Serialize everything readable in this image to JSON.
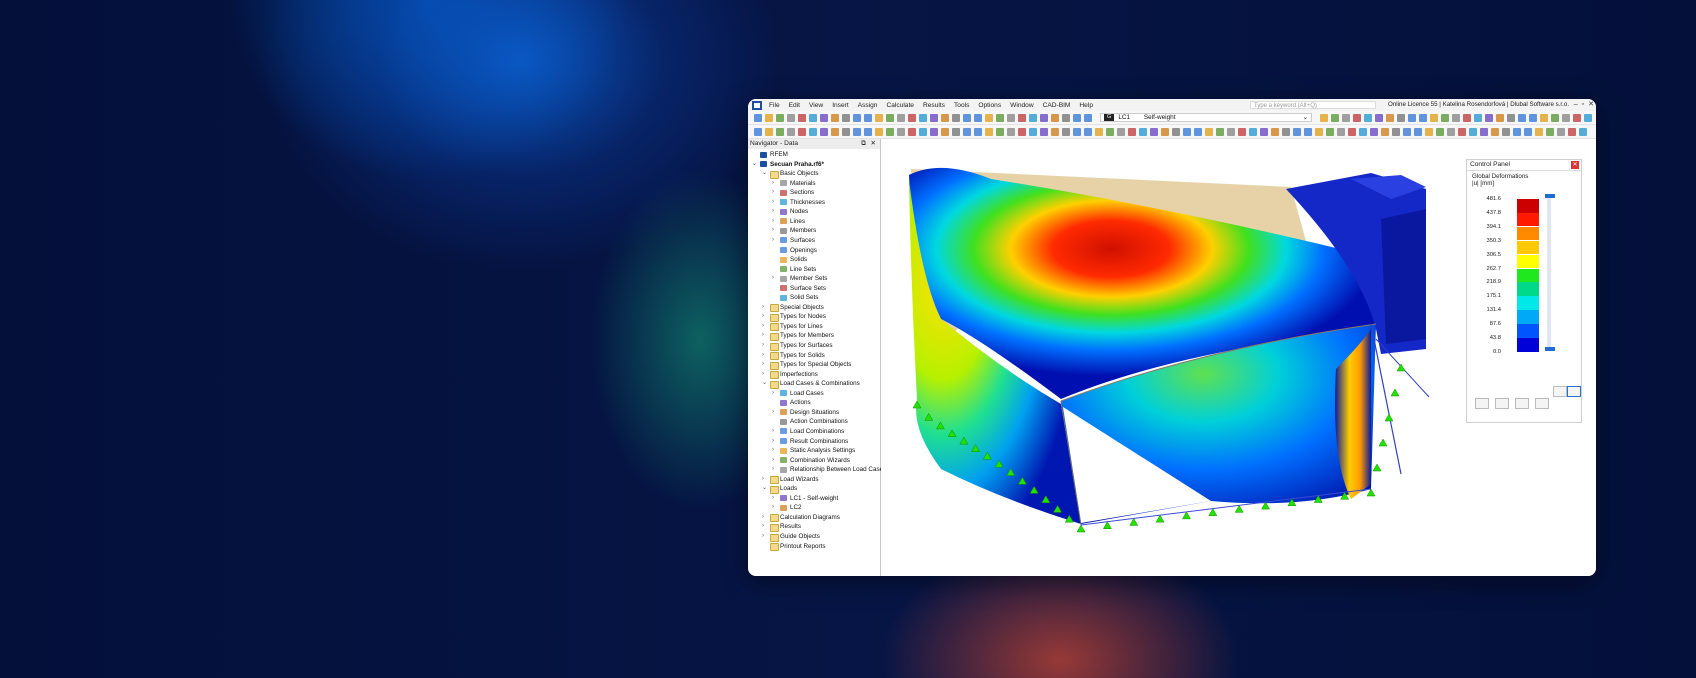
{
  "menu": [
    "File",
    "Edit",
    "View",
    "Insert",
    "Assign",
    "Calculate",
    "Results",
    "Tools",
    "Options",
    "Window",
    "CAD-BIM",
    "Help"
  ],
  "search_placeholder": "Type a keyword (Alt+Q)",
  "licence": "Online Licence 55 | Katelina Rosendorfová | Dlubal Software s.r.o.",
  "load_case": {
    "tag": "G",
    "id": "LC1",
    "name": "Self-weight"
  },
  "navigator": {
    "title": "Navigator - Data",
    "rows": [
      {
        "label": "RFEM",
        "lvl": 0,
        "exp": ""
      },
      {
        "label": "Secuan Praha.rf6*",
        "lvl": 0,
        "exp": "v"
      },
      {
        "label": "Basic Objects",
        "lvl": 1,
        "exp": "v"
      },
      {
        "label": "Materials",
        "lvl": 2,
        "exp": ">"
      },
      {
        "label": "Sections",
        "lvl": 2,
        "exp": ">"
      },
      {
        "label": "Thicknesses",
        "lvl": 2,
        "exp": ">"
      },
      {
        "label": "Nodes",
        "lvl": 2,
        "exp": ">"
      },
      {
        "label": "Lines",
        "lvl": 2,
        "exp": ">"
      },
      {
        "label": "Members",
        "lvl": 2,
        "exp": ">"
      },
      {
        "label": "Surfaces",
        "lvl": 2,
        "exp": ">"
      },
      {
        "label": "Openings",
        "lvl": 2,
        "exp": ""
      },
      {
        "label": "Solids",
        "lvl": 2,
        "exp": ""
      },
      {
        "label": "Line Sets",
        "lvl": 2,
        "exp": ""
      },
      {
        "label": "Member Sets",
        "lvl": 2,
        "exp": ">"
      },
      {
        "label": "Surface Sets",
        "lvl": 2,
        "exp": ""
      },
      {
        "label": "Solid Sets",
        "lvl": 2,
        "exp": ""
      },
      {
        "label": "Special Objects",
        "lvl": 1,
        "exp": ">"
      },
      {
        "label": "Types for Nodes",
        "lvl": 1,
        "exp": ">"
      },
      {
        "label": "Types for Lines",
        "lvl": 1,
        "exp": ">"
      },
      {
        "label": "Types for Members",
        "lvl": 1,
        "exp": ">"
      },
      {
        "label": "Types for Surfaces",
        "lvl": 1,
        "exp": ">"
      },
      {
        "label": "Types for Solids",
        "lvl": 1,
        "exp": ">"
      },
      {
        "label": "Types for Special Objects",
        "lvl": 1,
        "exp": ">"
      },
      {
        "label": "Imperfections",
        "lvl": 1,
        "exp": ">"
      },
      {
        "label": "Load Cases & Combinations",
        "lvl": 1,
        "exp": "v"
      },
      {
        "label": "Load Cases",
        "lvl": 2,
        "exp": ">"
      },
      {
        "label": "Actions",
        "lvl": 2,
        "exp": ""
      },
      {
        "label": "Design Situations",
        "lvl": 2,
        "exp": ">"
      },
      {
        "label": "Action Combinations",
        "lvl": 2,
        "exp": ""
      },
      {
        "label": "Load Combinations",
        "lvl": 2,
        "exp": ">"
      },
      {
        "label": "Result Combinations",
        "lvl": 2,
        "exp": ">"
      },
      {
        "label": "Static Analysis Settings",
        "lvl": 2,
        "exp": ">"
      },
      {
        "label": "Combination Wizards",
        "lvl": 2,
        "exp": ">"
      },
      {
        "label": "Relationship Between Load Case",
        "lvl": 2,
        "exp": ">"
      },
      {
        "label": "Load Wizards",
        "lvl": 1,
        "exp": ">"
      },
      {
        "label": "Loads",
        "lvl": 1,
        "exp": "v"
      },
      {
        "label": "LC1 - Self-weight",
        "lvl": 2,
        "exp": ">"
      },
      {
        "label": "LC2",
        "lvl": 2,
        "exp": ">"
      },
      {
        "label": "Calculation Diagrams",
        "lvl": 1,
        "exp": ">"
      },
      {
        "label": "Results",
        "lvl": 1,
        "exp": ">"
      },
      {
        "label": "Guide Objects",
        "lvl": 1,
        "exp": ">"
      },
      {
        "label": "Printout Reports",
        "lvl": 1,
        "exp": ""
      }
    ]
  },
  "control_panel": {
    "title": "Control Panel",
    "subtitle": "Global Deformations",
    "unit": "|u| [mm]",
    "values": [
      "481.6",
      "437.8",
      "394.1",
      "350.3",
      "306.5",
      "262.7",
      "218.9",
      "175.1",
      "131.4",
      "87.6",
      "43.8",
      "0.0"
    ],
    "colors": [
      "#cc0000",
      "#ff1a00",
      "#ff8a00",
      "#ffc800",
      "#ffff00",
      "#1fe81f",
      "#00d88a",
      "#00e8e8",
      "#00a8f8",
      "#0055ff",
      "#0000d8"
    ]
  }
}
